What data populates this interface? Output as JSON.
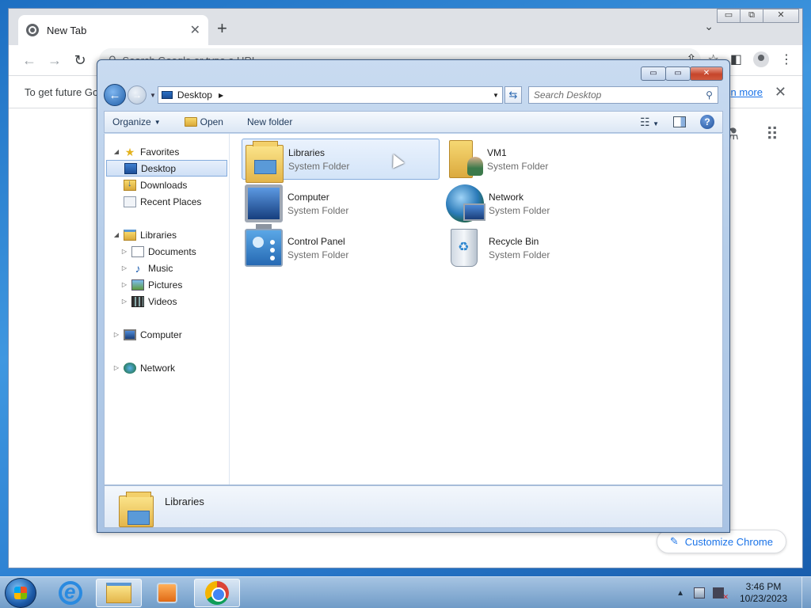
{
  "chrome": {
    "tab_title": "New Tab",
    "tab_close": "✕",
    "new_tab": "+",
    "tab_dropdown": "⌄",
    "omnibox_placeholder": "Search Google or type a URL",
    "infobar_text": "To get future Go",
    "infobar_link": "n more",
    "infobar_close": "✕",
    "customize_label": "Customize Chrome",
    "window_controls": {
      "minimize": "▭",
      "maximize": "⧉",
      "close": "✕"
    }
  },
  "explorer": {
    "window_controls": {
      "minimize": "▭",
      "maximize": "▭",
      "close": "✕"
    },
    "address_location": "Desktop",
    "search_placeholder": "Search Desktop",
    "commands": {
      "organize": "Organize",
      "open": "Open",
      "new_folder": "New folder"
    },
    "nav_pane": [
      {
        "label": "Favorites",
        "icon": "star-icon",
        "level": 0,
        "expanded": true
      },
      {
        "label": "Desktop",
        "icon": "desktop-icon",
        "level": 1,
        "selected": true
      },
      {
        "label": "Downloads",
        "icon": "downloads-icon",
        "level": 1
      },
      {
        "label": "Recent Places",
        "icon": "recent-places-icon",
        "level": 1
      },
      {
        "label": "Libraries",
        "icon": "libraries-icon",
        "level": 0,
        "expanded": true
      },
      {
        "label": "Documents",
        "icon": "documents-icon",
        "level": 1,
        "collapsed": true
      },
      {
        "label": "Music",
        "icon": "music-icon",
        "level": 1,
        "collapsed": true
      },
      {
        "label": "Pictures",
        "icon": "pictures-icon",
        "level": 1,
        "collapsed": true
      },
      {
        "label": "Videos",
        "icon": "videos-icon",
        "level": 1,
        "collapsed": true
      },
      {
        "label": "Computer",
        "icon": "computer-icon",
        "level": 0,
        "collapsed": true
      },
      {
        "label": "Network",
        "icon": "network-icon",
        "level": 0,
        "collapsed": true
      }
    ],
    "items": [
      {
        "name": "Libraries",
        "type": "System Folder",
        "icon": "libraries-icon",
        "selected": true
      },
      {
        "name": "VM1",
        "type": "System Folder",
        "icon": "user-folder-icon"
      },
      {
        "name": "Computer",
        "type": "System Folder",
        "icon": "computer-icon"
      },
      {
        "name": "Network",
        "type": "System Folder",
        "icon": "network-icon"
      },
      {
        "name": "Control Panel",
        "type": "System Folder",
        "icon": "control-panel-icon"
      },
      {
        "name": "Recycle Bin",
        "type": "System Folder",
        "icon": "recycle-bin-icon"
      }
    ],
    "details_name": "Libraries"
  },
  "taskbar": {
    "time": "3:46 PM",
    "date": "10/23/2023",
    "tray_expand": "▲"
  }
}
